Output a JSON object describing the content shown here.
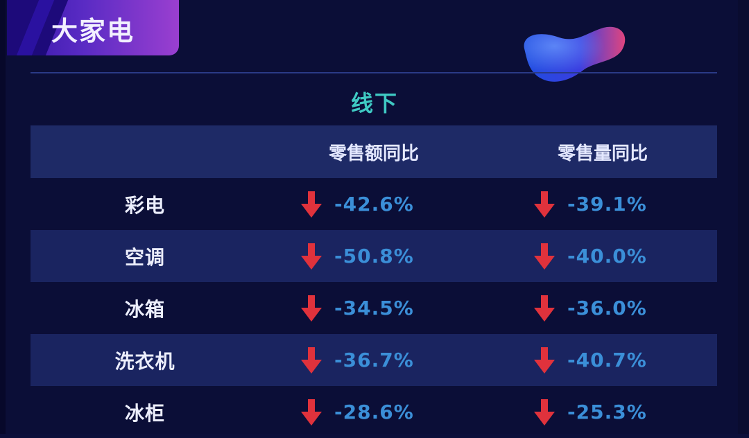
{
  "header": {
    "title": "大家电"
  },
  "subtitle": "线下",
  "colors": {
    "background": "#0b0e37",
    "title_tab": "#5a2bc4",
    "subtitle": "#3fc9c3",
    "value_text": "#3b8fd8",
    "down_arrow": "#e0323c",
    "header_row": "#1e2a66"
  },
  "icons": {
    "down": "arrow-down-icon",
    "decor": "gradient-blob-decoration"
  },
  "chart_data": {
    "type": "table",
    "columns": [
      "",
      "零售额同比",
      "零售量同比"
    ],
    "rows": [
      {
        "category": "彩电",
        "sales_yoy": "-42.6%",
        "volume_yoy": "-39.1%"
      },
      {
        "category": "空调",
        "sales_yoy": "-50.8%",
        "volume_yoy": "-40.0%"
      },
      {
        "category": "冰箱",
        "sales_yoy": "-34.5%",
        "volume_yoy": "-36.0%"
      },
      {
        "category": "洗衣机",
        "sales_yoy": "-36.7%",
        "volume_yoy": "-40.7%"
      },
      {
        "category": "冰柜",
        "sales_yoy": "-28.6%",
        "volume_yoy": "-25.3%"
      }
    ]
  }
}
